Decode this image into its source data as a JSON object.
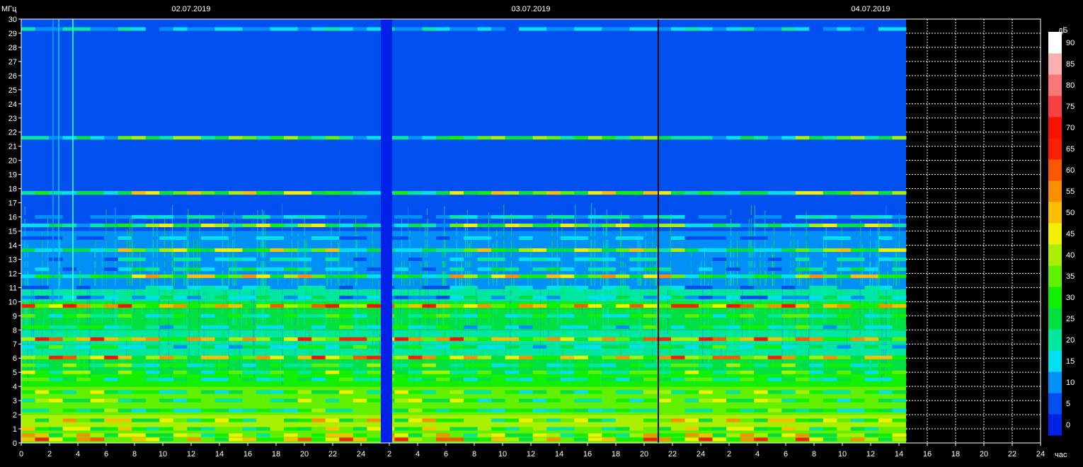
{
  "chart_data": {
    "type": "heatmap",
    "ylabel": "МГц",
    "xlabel": "час",
    "colorbar_label": "дБ",
    "dates": [
      "02.07.2019",
      "03.07.2019",
      "04.07.2019"
    ],
    "ylim": [
      0,
      30
    ],
    "yticks": [
      "0",
      "1",
      "2",
      "3",
      "4",
      "5",
      "6",
      "7",
      "8",
      "9",
      "10",
      "11",
      "12",
      "13",
      "14",
      "15",
      "16",
      "17",
      "18",
      "19",
      "20",
      "21",
      "22",
      "23",
      "24",
      "25",
      "26",
      "27",
      "28",
      "29",
      "30"
    ],
    "xticks": [
      "0",
      "2",
      "4",
      "6",
      "8",
      "10",
      "12",
      "14",
      "16",
      "18",
      "20",
      "22",
      "24",
      "2",
      "4",
      "6",
      "8",
      "10",
      "12",
      "14",
      "16",
      "18",
      "20",
      "22",
      "24",
      "2",
      "4",
      "6",
      "8",
      "10",
      "12",
      "14",
      "16",
      "18",
      "20",
      "22",
      "24"
    ],
    "data_hours_end": 62.5,
    "gap_hours": [
      25.4,
      26.2
    ],
    "marker_hour": 45,
    "colorbar": {
      "ticks": [
        "0",
        "5",
        "10",
        "15",
        "20",
        "25",
        "30",
        "35",
        "40",
        "45",
        "50",
        "55",
        "60",
        "65",
        "70",
        "75",
        "80",
        "85",
        "90"
      ],
      "colors": [
        "#0022e8",
        "#0050f0",
        "#0090f8",
        "#00e0f0",
        "#00e8a0",
        "#00e040",
        "#10f000",
        "#60f000",
        "#a8f000",
        "#f0f000",
        "#f8c000",
        "#f89000",
        "#f85800",
        "#f82000",
        "#f81000",
        "#f84040",
        "#f87878",
        "#f8b0b0",
        "#ffffff"
      ]
    },
    "bands": [
      {
        "f": 0.25,
        "level": 60
      },
      {
        "f": 0.55,
        "level": 52
      },
      {
        "f": 1.0,
        "level": 45
      },
      {
        "f": 1.6,
        "level": 50
      },
      {
        "f": 2.3,
        "level": 35
      },
      {
        "f": 3.0,
        "level": 42
      },
      {
        "f": 3.6,
        "level": 40
      },
      {
        "f": 4.5,
        "level": 34
      },
      {
        "f": 5.0,
        "level": 40
      },
      {
        "f": 5.5,
        "level": 36
      },
      {
        "f": 6.05,
        "level": 62
      },
      {
        "f": 6.8,
        "level": 30
      },
      {
        "f": 7.35,
        "level": 65
      },
      {
        "f": 8.2,
        "level": 30
      },
      {
        "f": 9.0,
        "level": 34
      },
      {
        "f": 9.7,
        "level": 66
      },
      {
        "f": 10.3,
        "level": 22
      },
      {
        "f": 11.0,
        "level": 18
      },
      {
        "f": 11.8,
        "level": 50
      },
      {
        "f": 12.3,
        "level": 22
      },
      {
        "f": 13.0,
        "level": 20
      },
      {
        "f": 13.65,
        "level": 44
      },
      {
        "f": 14.5,
        "level": 15
      },
      {
        "f": 15.4,
        "level": 42
      },
      {
        "f": 16.0,
        "level": 20
      },
      {
        "f": 17.7,
        "level": 46
      },
      {
        "f": 21.6,
        "level": 38
      },
      {
        "f": 29.3,
        "level": 18
      }
    ]
  }
}
